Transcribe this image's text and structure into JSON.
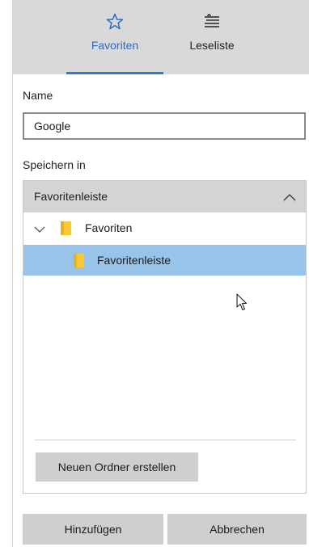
{
  "tabs": {
    "favorites": {
      "label": "Favoriten",
      "icon": "star-icon",
      "selected": true
    },
    "reading_list": {
      "label": "Leseliste",
      "icon": "reading-list-icon"
    }
  },
  "name_section": {
    "label": "Name",
    "value": "Google"
  },
  "save_in": {
    "label": "Speichern in",
    "selected_folder": "Favoritenleiste",
    "tree": [
      {
        "label": "Favoriten",
        "expanded": true
      },
      {
        "label": "Favoritenleiste",
        "selected": true
      }
    ],
    "new_folder_label": "Neuen Ordner erstellen"
  },
  "actions": {
    "add_label": "Hinzufügen",
    "cancel_label": "Abbrechen"
  },
  "colors": {
    "accent": "#2f78d3",
    "header_bg": "#d9d9d9",
    "selected_row": "#99c4ea",
    "folder": "#f6c935"
  }
}
